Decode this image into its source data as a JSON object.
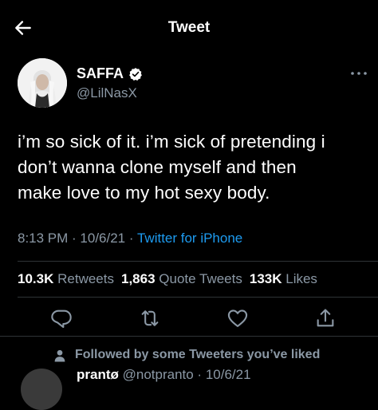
{
  "header": {
    "title": "Tweet",
    "back_icon": "back-arrow-icon"
  },
  "author": {
    "name": "SAFFA",
    "handle": "@LilNasX",
    "verified": true
  },
  "tweet": {
    "lines": [
      "i’m so sick of it. i’m sick of pretending i",
      "don’t wanna clone myself and then",
      "make love to my hot sexy body."
    ],
    "time": "8:13 PM",
    "sep1": " · ",
    "date": "10/6/21",
    "sep2": " · ",
    "source": "Twitter for iPhone"
  },
  "stats": {
    "retweets": {
      "count": "10.3K",
      "label": "Retweets"
    },
    "quotes": {
      "count": "1,863",
      "label": "Quote Tweets"
    },
    "likes": {
      "count": "133K",
      "label": "Likes"
    }
  },
  "actions": [
    "reply-icon",
    "retweet-icon",
    "like-icon",
    "share-icon"
  ],
  "social_context": "Followed by some Tweeters you’ve liked",
  "reply": {
    "name": "prantø",
    "rest": " @notpranto · 10/6/21"
  },
  "colors": {
    "background": "#000000",
    "text": "#e7e9ea",
    "secondary": "#8b98a5",
    "link": "#1d9bf0",
    "border": "#2f3336"
  }
}
